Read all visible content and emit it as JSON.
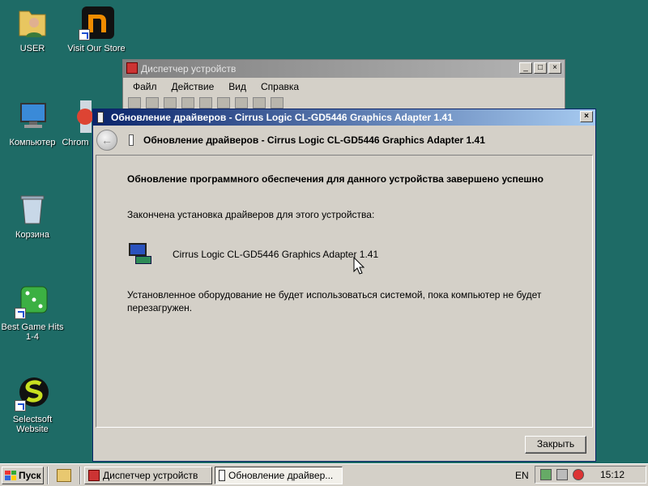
{
  "desktop": {
    "icons": [
      {
        "label": "USER",
        "icon": "user-folder-icon"
      },
      {
        "label": "Visit Our Store",
        "icon": "store-icon"
      },
      {
        "label": "Компьютер",
        "icon": "computer-icon"
      },
      {
        "label": "Chrom",
        "icon": "chrome-icon"
      },
      {
        "label": "Корзина",
        "icon": "recycle-bin-icon"
      },
      {
        "label": "Best Game Hits 1-4",
        "icon": "dice-icon"
      },
      {
        "label": "Selectsoft Website",
        "icon": "selectsoft-icon"
      }
    ]
  },
  "device_manager": {
    "title": "Диспетчер устройств",
    "menu": [
      "Файл",
      "Действие",
      "Вид",
      "Справка"
    ]
  },
  "dialog": {
    "title": "Обновление драйверов - Cirrus Logic CL-GD5446 Graphics Adapter 1.41",
    "header": "Обновление драйверов - Cirrus Logic CL-GD5446 Graphics Adapter 1.41",
    "success_title": "Обновление программного обеспечения для данного устройства завершено успешно",
    "install_text": "Закончена установка драйверов для этого устройства:",
    "device_name": "Cirrus Logic CL-GD5446 Graphics Adapter 1.41",
    "warning_text": "Установленное оборудование не будет использоваться системой, пока компьютер не будет перезагружен.",
    "close_button": "Закрыть",
    "title_close": "×"
  },
  "taskbar": {
    "start_label": "Пуск",
    "tasks": [
      {
        "label": "Диспетчер устройств",
        "active": false
      },
      {
        "label": "Обновление драйвер...",
        "active": true
      }
    ],
    "language": "EN",
    "clock": "15:12"
  },
  "colors": {
    "desktop": "#1e6b66",
    "active_title_start": "#0a246a",
    "active_title_end": "#a6caf0",
    "inactive_title": "#808080",
    "face": "#d4d0c8"
  }
}
